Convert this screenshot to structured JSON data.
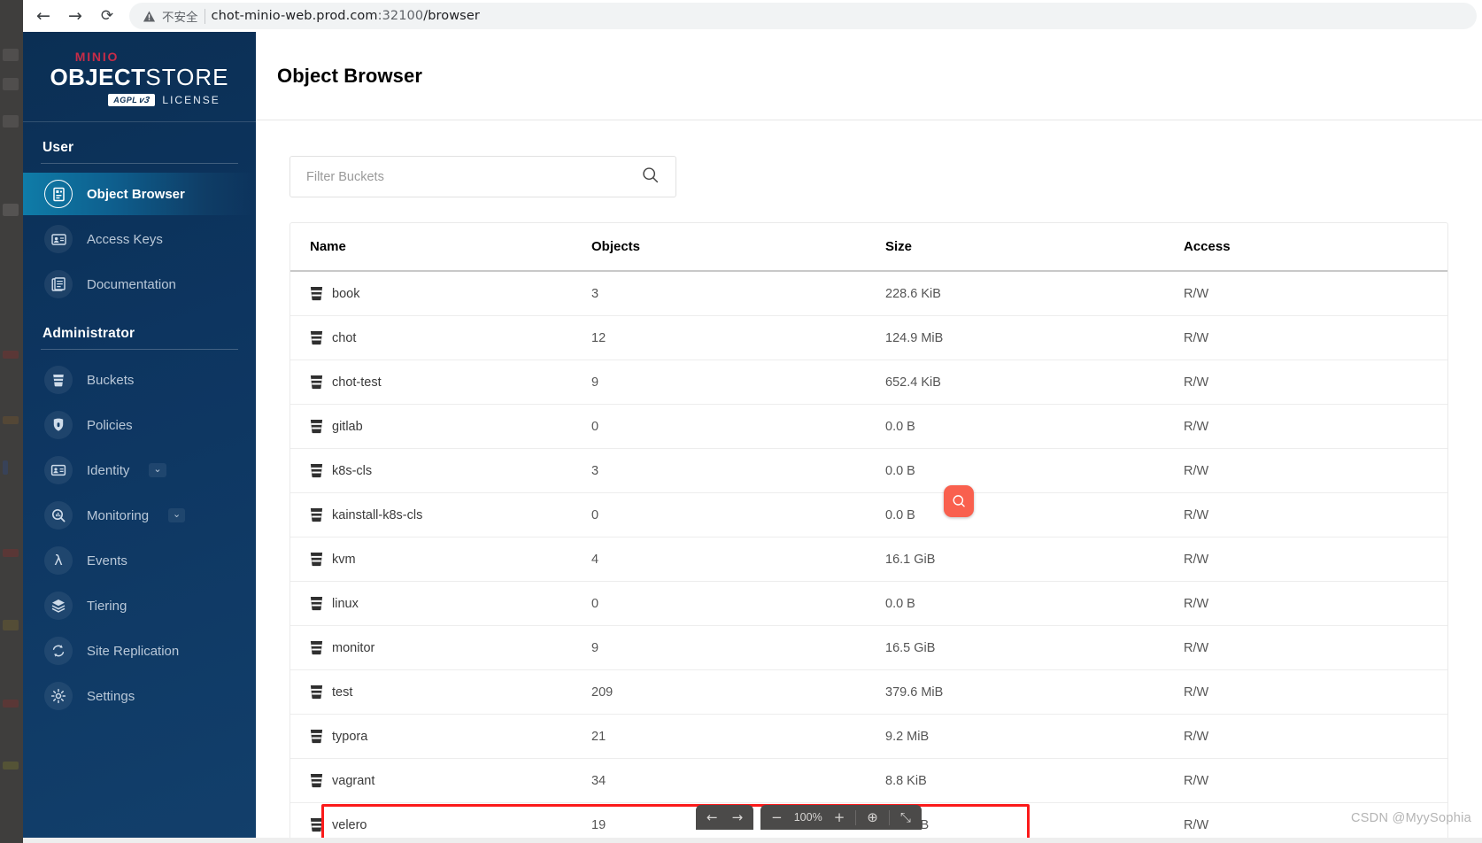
{
  "browser": {
    "back_label": "←",
    "forward_label": "→",
    "reload_label": "⟳",
    "security_label": "不安全",
    "url_host": "chot-minio-web.prod.com",
    "url_port": ":32100",
    "url_path": "/browser"
  },
  "sidebar": {
    "logo": {
      "brand": "MINIO",
      "object": "OBJECT",
      "store": "STORE",
      "badge_agpl": "AGPL",
      "badge_v3": "v3",
      "license_word": "LICENSE"
    },
    "sections": [
      {
        "title": "User",
        "items": [
          {
            "label": "Object Browser",
            "icon": "object-browser-icon",
            "active": true,
            "chevron": ""
          },
          {
            "label": "Access Keys",
            "icon": "access-keys-icon",
            "active": false,
            "chevron": ""
          },
          {
            "label": "Documentation",
            "icon": "documentation-icon",
            "active": false,
            "chevron": ""
          }
        ]
      },
      {
        "title": "Administrator",
        "items": [
          {
            "label": "Buckets",
            "icon": "bucket-icon",
            "active": false,
            "chevron": ""
          },
          {
            "label": "Policies",
            "icon": "policies-lock-icon",
            "active": false,
            "chevron": ""
          },
          {
            "label": "Identity",
            "icon": "identity-card-icon",
            "active": false,
            "chevron": "⌄"
          },
          {
            "label": "Monitoring",
            "icon": "monitoring-magnifier-icon",
            "active": false,
            "chevron": "⌄"
          },
          {
            "label": "Events",
            "icon": "events-lambda-icon",
            "active": false,
            "chevron": ""
          },
          {
            "label": "Tiering",
            "icon": "tiering-layers-icon",
            "active": false,
            "chevron": ""
          },
          {
            "label": "Site Replication",
            "icon": "site-replication-icon",
            "active": false,
            "chevron": ""
          },
          {
            "label": "Settings",
            "icon": "gear-icon",
            "active": false,
            "chevron": ""
          }
        ]
      }
    ]
  },
  "main": {
    "page_title": "Object Browser",
    "filter": {
      "placeholder": "Filter Buckets",
      "value": ""
    },
    "table": {
      "columns": [
        "Name",
        "Objects",
        "Size",
        "Access"
      ],
      "rows": [
        {
          "name": "book",
          "objects": "3",
          "size": "228.6 KiB",
          "access": "R/W"
        },
        {
          "name": "chot",
          "objects": "12",
          "size": "124.9 MiB",
          "access": "R/W"
        },
        {
          "name": "chot-test",
          "objects": "9",
          "size": "652.4 KiB",
          "access": "R/W"
        },
        {
          "name": "gitlab",
          "objects": "0",
          "size": "0.0 B",
          "access": "R/W"
        },
        {
          "name": "k8s-cls",
          "objects": "3",
          "size": "0.0 B",
          "access": "R/W"
        },
        {
          "name": "kainstall-k8s-cls",
          "objects": "0",
          "size": "0.0 B",
          "access": "R/W"
        },
        {
          "name": "kvm",
          "objects": "4",
          "size": "16.1 GiB",
          "access": "R/W"
        },
        {
          "name": "linux",
          "objects": "0",
          "size": "0.0 B",
          "access": "R/W"
        },
        {
          "name": "monitor",
          "objects": "9",
          "size": "16.5 GiB",
          "access": "R/W"
        },
        {
          "name": "test",
          "objects": "209",
          "size": "379.6 MiB",
          "access": "R/W"
        },
        {
          "name": "typora",
          "objects": "21",
          "size": "9.2 MiB",
          "access": "R/W"
        },
        {
          "name": "vagrant",
          "objects": "34",
          "size": "8.8 KiB",
          "access": "R/W"
        },
        {
          "name": "velero",
          "objects": "19",
          "size": "7.4 MiB",
          "access": "R/W"
        }
      ]
    }
  },
  "annotations": {
    "highlight_color": "#fb1a1a",
    "badge_color": "#f9604e",
    "badge_icon": "search-icon"
  },
  "tool_bar": {
    "prev_label": "←",
    "next_label": "→",
    "zoom_out_label": "−",
    "zoom_level": "100%",
    "zoom_in_label": "+",
    "download_label": "⊕",
    "collapse_label": "⤡"
  },
  "watermark": "CSDN @MyySophia"
}
